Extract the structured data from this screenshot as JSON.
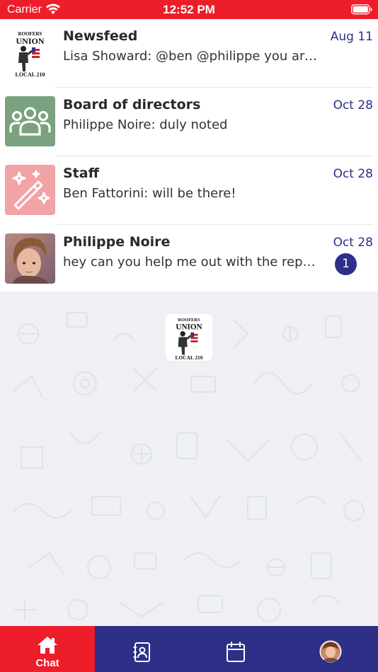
{
  "status_bar": {
    "carrier": "Carrier",
    "time": "12:52 PM"
  },
  "colors": {
    "brand_red": "#ee1d2a",
    "brand_navy": "#2e2f86",
    "group_green": "#7aa27e",
    "staff_pink": "#f1a3a6"
  },
  "chats": [
    {
      "title": "Newsfeed",
      "preview": "Lisa Showard: @ben @philippe you are …",
      "date": "Aug 11",
      "avatar": "union-logo-icon",
      "logo_text": [
        "ROOFERS",
        "UNION",
        "LOCAL 210"
      ]
    },
    {
      "title": "Board of directors",
      "preview": "Philippe Noire: duly noted",
      "date": "Oct 28",
      "avatar": "group-people-icon"
    },
    {
      "title": "Staff",
      "preview": "Ben Fattorini: will be there!",
      "date": "Oct 28",
      "avatar": "magic-wand-icon"
    },
    {
      "title": "Philippe Noire",
      "preview": "hey can you help me out with the repo…",
      "date": "Oct 28",
      "avatar": "user-photo",
      "unread_count": "1"
    }
  ],
  "background": {
    "logo": "union-logo-icon",
    "logo_text": [
      "ROOFERS",
      "UNION",
      "LOCAL 210"
    ]
  },
  "tab_bar": {
    "tabs": [
      {
        "label": "Chat",
        "icon": "home-icon",
        "active": true
      },
      {
        "label": "",
        "icon": "contacts-icon",
        "active": false
      },
      {
        "label": "",
        "icon": "calendar-icon",
        "active": false
      },
      {
        "label": "",
        "icon": "profile-avatar",
        "active": false
      }
    ]
  }
}
